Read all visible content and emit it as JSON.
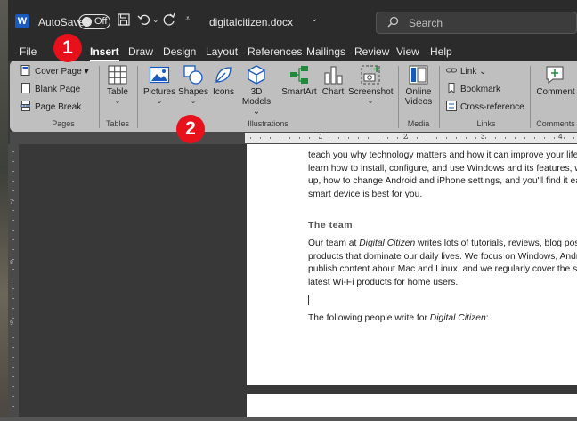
{
  "titlebar": {
    "logo_letter": "W",
    "autosave_label": "AutoSave",
    "autosave_state": "Off",
    "filename": "digitalcitizen.docx",
    "search_placeholder": "Search"
  },
  "tabs": [
    "File",
    "Insert",
    "Draw",
    "Design",
    "Layout",
    "References",
    "Mailings",
    "Review",
    "View",
    "Help"
  ],
  "active_tab": "Insert",
  "ribbon": {
    "pages": {
      "label": "Pages",
      "cover_page": "Cover Page",
      "blank_page": "Blank Page",
      "page_break": "Page Break"
    },
    "tables": {
      "label": "Tables",
      "table": "Table"
    },
    "illustrations": {
      "label": "Illustrations",
      "pictures": "Pictures",
      "shapes": "Shapes",
      "icons": "Icons",
      "models_3d_line1": "3D",
      "models_3d_line2": "Models",
      "smartart": "SmartArt",
      "chart": "Chart",
      "screenshot": "Screenshot"
    },
    "media": {
      "label": "Media",
      "online_videos_line1": "Online",
      "online_videos_line2": "Videos"
    },
    "links": {
      "label": "Links",
      "link": "Link",
      "bookmark": "Bookmark",
      "cross_reference": "Cross-reference"
    },
    "comments": {
      "label": "Comments",
      "comment": "Comment"
    }
  },
  "ruler": {
    "numbers": [
      "1",
      "2",
      "3",
      "4"
    ],
    "left_numbers": [
      "7",
      "8",
      "9"
    ]
  },
  "document": {
    "para1": [
      "teach you why technology matters and how it can improve your life. Re",
      "learn how to install, configure, and use Windows and its features, what",
      "up, how to change Android and iPhone settings, and you'll find it easier",
      "smart device is best for you."
    ],
    "heading": "The team",
    "para2": [
      [
        "Our team at ",
        "Digital Citizen",
        " writes lots of tutorials, reviews, blog posts, a"
      ],
      "products that dominate our daily lives. We focus on Windows, Android,",
      "publish content about Mac and Linux, and we regularly cover the smart",
      "latest Wi-Fi products for home users."
    ],
    "para3": [
      "The following people write for ",
      "Digital Citizen",
      ":"
    ]
  },
  "callouts": [
    "1",
    "2"
  ],
  "colors": {
    "accent_word": "#185abd",
    "callout_red": "#e8101a",
    "ribbon_bg": "#bfbfbf"
  }
}
